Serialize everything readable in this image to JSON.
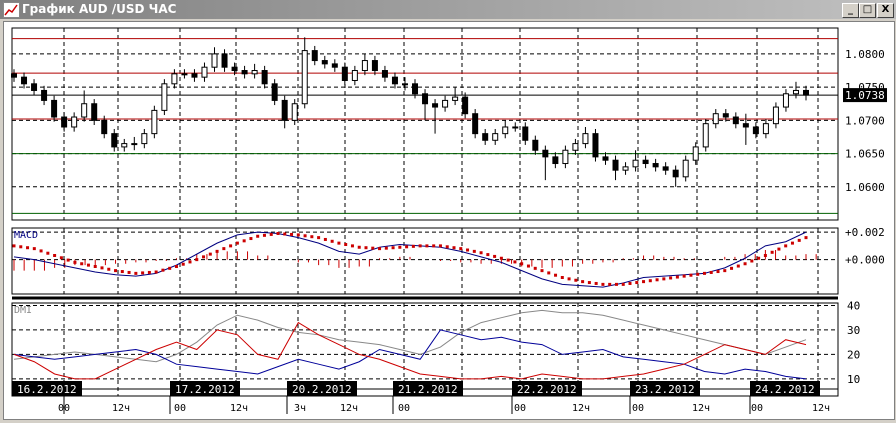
{
  "window": {
    "title": "График AUD /USD  ЧАС",
    "minimize": "_",
    "maximize": "□",
    "close": "X"
  },
  "colors": {
    "bull": "#ffffff",
    "bear": "#000000",
    "resistance": "#b00000",
    "support": "#006000",
    "macd": "#000080",
    "signal": "#cc0000",
    "plus_di": "#cc0000",
    "minus_di": "#000099",
    "adx": "#888888"
  },
  "price_panel": {
    "current_price": "1.0738",
    "y_ticks": [
      "1.0800",
      "1.0750",
      "1.0700",
      "1.0650",
      "1.0600"
    ],
    "red_levels": [
      1.0823,
      1.0771,
      1.0702
    ],
    "green_levels": [
      1.065,
      1.056
    ],
    "range": [
      1.055,
      1.0839
    ]
  },
  "chart_data": [
    {
      "type": "candlestick",
      "range": [
        1.055,
        1.0839
      ],
      "candles": [
        [
          1.077,
          1.0777,
          1.0758,
          1.0765
        ],
        [
          1.0765,
          1.0772,
          1.0748,
          1.0755
        ],
        [
          1.0755,
          1.0762,
          1.0738,
          1.0745
        ],
        [
          1.0745,
          1.0752,
          1.0723,
          1.073
        ],
        [
          1.073,
          1.0737,
          1.0698,
          1.0705
        ],
        [
          1.0705,
          1.0712,
          1.0683,
          1.069
        ],
        [
          1.069,
          1.0712,
          1.0683,
          1.0705
        ],
        [
          1.0705,
          1.0745,
          1.0698,
          1.0725
        ],
        [
          1.0725,
          1.0732,
          1.0693,
          1.07
        ],
        [
          1.07,
          1.0707,
          1.0673,
          1.068
        ],
        [
          1.068,
          1.0687,
          1.0653,
          1.066
        ],
        [
          1.066,
          1.0672,
          1.0653,
          1.0665
        ],
        [
          1.0665,
          1.0675,
          1.0655,
          1.0665
        ],
        [
          1.0665,
          1.0687,
          1.0658,
          1.068
        ],
        [
          1.068,
          1.0722,
          1.0673,
          1.0715
        ],
        [
          1.0715,
          1.0762,
          1.0708,
          1.0755
        ],
        [
          1.0755,
          1.0777,
          1.0748,
          1.077
        ],
        [
          1.077,
          1.0777,
          1.0763,
          1.077
        ],
        [
          1.077,
          1.0777,
          1.0758,
          1.0765
        ],
        [
          1.0765,
          1.0787,
          1.0758,
          1.078
        ],
        [
          1.078,
          1.081,
          1.0773,
          1.08
        ],
        [
          1.08,
          1.0807,
          1.0773,
          1.078
        ],
        [
          1.078,
          1.0787,
          1.0768,
          1.0775
        ],
        [
          1.0775,
          1.0782,
          1.0763,
          1.077
        ],
        [
          1.077,
          1.0785,
          1.0763,
          1.0775
        ],
        [
          1.0775,
          1.0782,
          1.0748,
          1.0755
        ],
        [
          1.0755,
          1.0762,
          1.0723,
          1.073
        ],
        [
          1.073,
          1.0737,
          1.0688,
          1.07
        ],
        [
          1.07,
          1.0732,
          1.0693,
          1.0725
        ],
        [
          1.0725,
          1.0825,
          1.0718,
          1.0805
        ],
        [
          1.0805,
          1.0812,
          1.0783,
          1.079
        ],
        [
          1.079,
          1.0797,
          1.0778,
          1.0785
        ],
        [
          1.0785,
          1.0792,
          1.0773,
          1.078
        ],
        [
          1.078,
          1.0787,
          1.0753,
          1.076
        ],
        [
          1.076,
          1.0782,
          1.0753,
          1.0775
        ],
        [
          1.0775,
          1.08,
          1.0768,
          1.079
        ],
        [
          1.079,
          1.0797,
          1.0768,
          1.0775
        ],
        [
          1.0775,
          1.0782,
          1.0758,
          1.0765
        ],
        [
          1.0765,
          1.0772,
          1.0748,
          1.0755
        ],
        [
          1.0755,
          1.0765,
          1.0745,
          1.0755
        ],
        [
          1.0755,
          1.0762,
          1.0733,
          1.074
        ],
        [
          1.074,
          1.0747,
          1.07,
          1.0725
        ],
        [
          1.0725,
          1.0732,
          1.068,
          1.072
        ],
        [
          1.072,
          1.0737,
          1.0713,
          1.073
        ],
        [
          1.073,
          1.075,
          1.0723,
          1.0735
        ],
        [
          1.0735,
          1.0742,
          1.0703,
          1.071
        ],
        [
          1.071,
          1.0717,
          1.0673,
          1.068
        ],
        [
          1.068,
          1.0687,
          1.0663,
          1.067
        ],
        [
          1.067,
          1.0687,
          1.0663,
          1.068
        ],
        [
          1.068,
          1.07,
          1.0673,
          1.069
        ],
        [
          1.069,
          1.0697,
          1.0683,
          1.069
        ],
        [
          1.069,
          1.0697,
          1.0663,
          1.067
        ],
        [
          1.067,
          1.0677,
          1.0648,
          1.0655
        ],
        [
          1.0655,
          1.0662,
          1.061,
          1.0645
        ],
        [
          1.0645,
          1.0652,
          1.0628,
          1.0635
        ],
        [
          1.0635,
          1.0662,
          1.0628,
          1.0655
        ],
        [
          1.0655,
          1.0672,
          1.0648,
          1.0665
        ],
        [
          1.0665,
          1.069,
          1.0658,
          1.068
        ],
        [
          1.068,
          1.0687,
          1.0638,
          1.0645
        ],
        [
          1.0645,
          1.0652,
          1.0633,
          1.064
        ],
        [
          1.064,
          1.0647,
          1.061,
          1.0625
        ],
        [
          1.0625,
          1.0637,
          1.0618,
          1.063
        ],
        [
          1.063,
          1.0655,
          1.0623,
          1.064
        ],
        [
          1.064,
          1.0647,
          1.0628,
          1.0635
        ],
        [
          1.0635,
          1.0642,
          1.0623,
          1.063
        ],
        [
          1.063,
          1.0637,
          1.0618,
          1.0625
        ],
        [
          1.0625,
          1.0632,
          1.06,
          1.0615
        ],
        [
          1.0615,
          1.0647,
          1.0608,
          1.064
        ],
        [
          1.064,
          1.0667,
          1.0633,
          1.066
        ],
        [
          1.066,
          1.0702,
          1.0653,
          1.0695
        ],
        [
          1.0695,
          1.0717,
          1.0688,
          1.071
        ],
        [
          1.071,
          1.0717,
          1.0698,
          1.0705
        ],
        [
          1.0705,
          1.0712,
          1.0688,
          1.0695
        ],
        [
          1.0695,
          1.071,
          1.0663,
          1.069
        ],
        [
          1.069,
          1.0697,
          1.0673,
          1.068
        ],
        [
          1.068,
          1.0702,
          1.0673,
          1.0695
        ],
        [
          1.0695,
          1.0727,
          1.0688,
          1.072
        ],
        [
          1.072,
          1.0747,
          1.0713,
          1.074
        ],
        [
          1.074,
          1.0758,
          1.0733,
          1.0745
        ],
        [
          1.0745,
          1.0752,
          1.073,
          1.0738
        ]
      ]
    },
    {
      "type": "line",
      "title": "MACD",
      "y_ticks": [
        "+0.002",
        "+0.000"
      ],
      "range": [
        -0.0025,
        0.0023
      ],
      "macd": [
        0.0002,
        0.0,
        -0.0003,
        -0.0006,
        -0.0009,
        -0.0011,
        -0.0012,
        -0.001,
        -0.0004,
        0.0004,
        0.0012,
        0.0018,
        0.002,
        0.0019,
        0.0016,
        0.0012,
        0.0006,
        0.0004,
        0.0009,
        0.0011,
        0.001,
        0.0009,
        0.0006,
        0.0002,
        -0.0002,
        -0.0008,
        -0.0014,
        -0.0018,
        -0.0019,
        -0.002,
        -0.0017,
        -0.0013,
        -0.0012,
        -0.0011,
        -0.001,
        -0.0006,
        0.0001,
        0.001,
        0.0013,
        0.002
      ],
      "signal": [
        0.001,
        0.0008,
        0.0003,
        -0.0002,
        -0.0005,
        -0.0008,
        -0.001,
        -0.0009,
        -0.0005,
        0.0,
        0.0006,
        0.0012,
        0.0017,
        0.0019,
        0.0018,
        0.0016,
        0.0012,
        0.0009,
        0.0008,
        0.0009,
        0.001,
        0.001,
        0.0008,
        0.0005,
        0.0001,
        -0.0003,
        -0.0008,
        -0.0013,
        -0.0016,
        -0.0018,
        -0.0018,
        -0.0016,
        -0.0014,
        -0.0012,
        -0.001,
        -0.0008,
        -0.0003,
        0.0003,
        0.001,
        0.0016
      ]
    },
    {
      "type": "line",
      "title": "DMI",
      "y_ticks": [
        "40",
        "30",
        "20",
        "10"
      ],
      "range": [
        3,
        41
      ],
      "plus_di": [
        20,
        17,
        12,
        10,
        10,
        14,
        18,
        22,
        25,
        22,
        30,
        28,
        20,
        18,
        33,
        28,
        24,
        20,
        18,
        15,
        12,
        11,
        10,
        10,
        11,
        10,
        12,
        11,
        10,
        10,
        11,
        12,
        14,
        16,
        20,
        24,
        22,
        20,
        26,
        24
      ],
      "minus_di": [
        20,
        19,
        18,
        19,
        20,
        21,
        22,
        20,
        16,
        15,
        14,
        13,
        12,
        15,
        18,
        16,
        14,
        17,
        22,
        20,
        18,
        30,
        28,
        26,
        27,
        25,
        24,
        20,
        21,
        22,
        19,
        18,
        17,
        16,
        13,
        12,
        14,
        13,
        11,
        10
      ],
      "adx": [
        18,
        19,
        20,
        21,
        20,
        19,
        18,
        17,
        20,
        25,
        32,
        36,
        34,
        31,
        29,
        28,
        26,
        25,
        24,
        22,
        20,
        23,
        29,
        33,
        35,
        37,
        38,
        37,
        37,
        36,
        34,
        32,
        30,
        28,
        26,
        24,
        22,
        20,
        23,
        26
      ]
    }
  ],
  "time_axis": {
    "dates": [
      "16.2.2012",
      "17.2.2012",
      "20.2.2012",
      "21.2.2012",
      "22.2.2012",
      "23.2.2012",
      "24.2.2012"
    ],
    "hour_ticks": [
      "00",
      "12ч",
      "00",
      "12ч",
      "3ч",
      "12ч",
      "00",
      "00",
      "12ч",
      "00",
      "12ч",
      "00",
      "12ч"
    ]
  }
}
